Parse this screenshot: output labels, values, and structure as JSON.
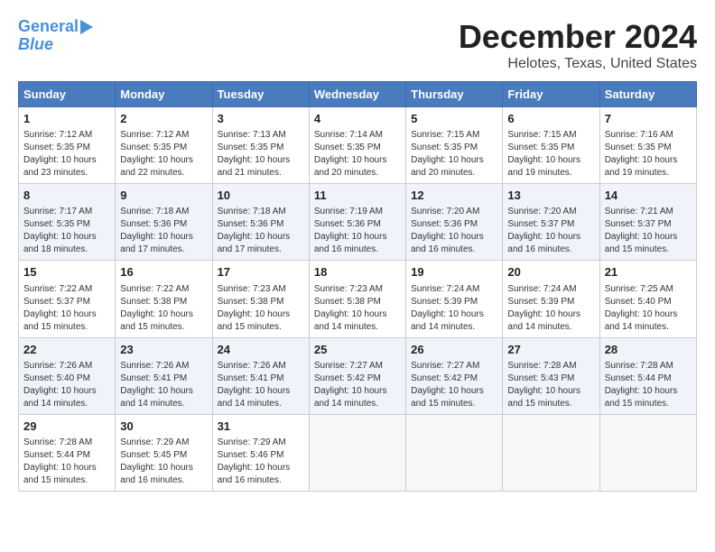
{
  "header": {
    "logo_line1": "General",
    "logo_line2": "Blue",
    "month_title": "December 2024",
    "location": "Helotes, Texas, United States"
  },
  "days_of_week": [
    "Sunday",
    "Monday",
    "Tuesday",
    "Wednesday",
    "Thursday",
    "Friday",
    "Saturday"
  ],
  "weeks": [
    [
      {
        "day": "1",
        "sunrise": "7:12 AM",
        "sunset": "5:35 PM",
        "daylight": "10 hours and 23 minutes."
      },
      {
        "day": "2",
        "sunrise": "7:12 AM",
        "sunset": "5:35 PM",
        "daylight": "10 hours and 22 minutes."
      },
      {
        "day": "3",
        "sunrise": "7:13 AM",
        "sunset": "5:35 PM",
        "daylight": "10 hours and 21 minutes."
      },
      {
        "day": "4",
        "sunrise": "7:14 AM",
        "sunset": "5:35 PM",
        "daylight": "10 hours and 20 minutes."
      },
      {
        "day": "5",
        "sunrise": "7:15 AM",
        "sunset": "5:35 PM",
        "daylight": "10 hours and 20 minutes."
      },
      {
        "day": "6",
        "sunrise": "7:15 AM",
        "sunset": "5:35 PM",
        "daylight": "10 hours and 19 minutes."
      },
      {
        "day": "7",
        "sunrise": "7:16 AM",
        "sunset": "5:35 PM",
        "daylight": "10 hours and 19 minutes."
      }
    ],
    [
      {
        "day": "8",
        "sunrise": "7:17 AM",
        "sunset": "5:35 PM",
        "daylight": "10 hours and 18 minutes."
      },
      {
        "day": "9",
        "sunrise": "7:18 AM",
        "sunset": "5:36 PM",
        "daylight": "10 hours and 17 minutes."
      },
      {
        "day": "10",
        "sunrise": "7:18 AM",
        "sunset": "5:36 PM",
        "daylight": "10 hours and 17 minutes."
      },
      {
        "day": "11",
        "sunrise": "7:19 AM",
        "sunset": "5:36 PM",
        "daylight": "10 hours and 16 minutes."
      },
      {
        "day": "12",
        "sunrise": "7:20 AM",
        "sunset": "5:36 PM",
        "daylight": "10 hours and 16 minutes."
      },
      {
        "day": "13",
        "sunrise": "7:20 AM",
        "sunset": "5:37 PM",
        "daylight": "10 hours and 16 minutes."
      },
      {
        "day": "14",
        "sunrise": "7:21 AM",
        "sunset": "5:37 PM",
        "daylight": "10 hours and 15 minutes."
      }
    ],
    [
      {
        "day": "15",
        "sunrise": "7:22 AM",
        "sunset": "5:37 PM",
        "daylight": "10 hours and 15 minutes."
      },
      {
        "day": "16",
        "sunrise": "7:22 AM",
        "sunset": "5:38 PM",
        "daylight": "10 hours and 15 minutes."
      },
      {
        "day": "17",
        "sunrise": "7:23 AM",
        "sunset": "5:38 PM",
        "daylight": "10 hours and 15 minutes."
      },
      {
        "day": "18",
        "sunrise": "7:23 AM",
        "sunset": "5:38 PM",
        "daylight": "10 hours and 14 minutes."
      },
      {
        "day": "19",
        "sunrise": "7:24 AM",
        "sunset": "5:39 PM",
        "daylight": "10 hours and 14 minutes."
      },
      {
        "day": "20",
        "sunrise": "7:24 AM",
        "sunset": "5:39 PM",
        "daylight": "10 hours and 14 minutes."
      },
      {
        "day": "21",
        "sunrise": "7:25 AM",
        "sunset": "5:40 PM",
        "daylight": "10 hours and 14 minutes."
      }
    ],
    [
      {
        "day": "22",
        "sunrise": "7:26 AM",
        "sunset": "5:40 PM",
        "daylight": "10 hours and 14 minutes."
      },
      {
        "day": "23",
        "sunrise": "7:26 AM",
        "sunset": "5:41 PM",
        "daylight": "10 hours and 14 minutes."
      },
      {
        "day": "24",
        "sunrise": "7:26 AM",
        "sunset": "5:41 PM",
        "daylight": "10 hours and 14 minutes."
      },
      {
        "day": "25",
        "sunrise": "7:27 AM",
        "sunset": "5:42 PM",
        "daylight": "10 hours and 14 minutes."
      },
      {
        "day": "26",
        "sunrise": "7:27 AM",
        "sunset": "5:42 PM",
        "daylight": "10 hours and 15 minutes."
      },
      {
        "day": "27",
        "sunrise": "7:28 AM",
        "sunset": "5:43 PM",
        "daylight": "10 hours and 15 minutes."
      },
      {
        "day": "28",
        "sunrise": "7:28 AM",
        "sunset": "5:44 PM",
        "daylight": "10 hours and 15 minutes."
      }
    ],
    [
      {
        "day": "29",
        "sunrise": "7:28 AM",
        "sunset": "5:44 PM",
        "daylight": "10 hours and 15 minutes."
      },
      {
        "day": "30",
        "sunrise": "7:29 AM",
        "sunset": "5:45 PM",
        "daylight": "10 hours and 16 minutes."
      },
      {
        "day": "31",
        "sunrise": "7:29 AM",
        "sunset": "5:46 PM",
        "daylight": "10 hours and 16 minutes."
      },
      null,
      null,
      null,
      null
    ]
  ],
  "labels": {
    "sunrise_prefix": "Sunrise: ",
    "sunset_prefix": "Sunset: ",
    "daylight_prefix": "Daylight: "
  }
}
